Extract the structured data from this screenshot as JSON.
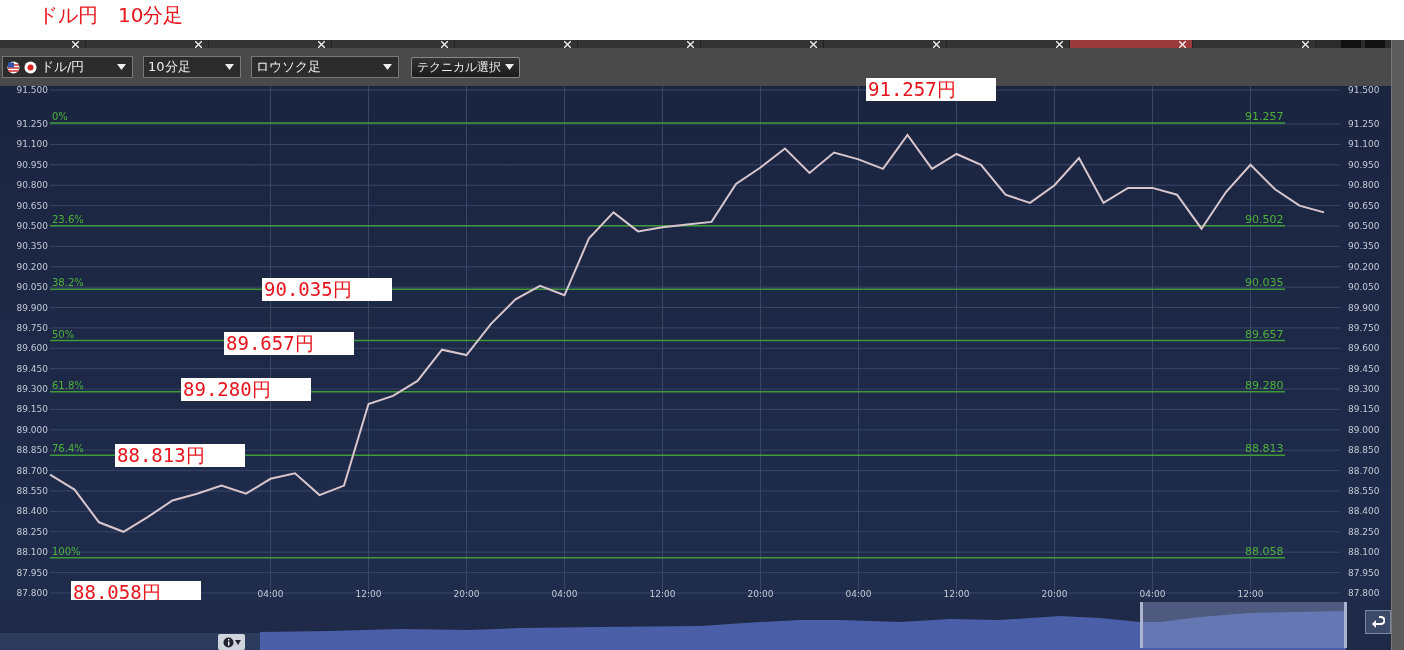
{
  "page_title": "ドル円　10分足",
  "tab_strip": {
    "tabs": [
      {
        "selected": false
      },
      {
        "selected": false
      },
      {
        "selected": false
      },
      {
        "selected": false
      },
      {
        "selected": false
      },
      {
        "selected": false
      },
      {
        "selected": false
      },
      {
        "selected": false
      },
      {
        "selected": false
      },
      {
        "selected": true
      },
      {
        "selected": false
      }
    ]
  },
  "toolbar": {
    "pair_select": {
      "value": "ドル/円"
    },
    "interval_select": {
      "value": "10分足"
    },
    "chart_type_select": {
      "value": "ロウソク足"
    },
    "technical_button": {
      "label": "テクニカル選択"
    }
  },
  "chart": {
    "chart_data": {
      "type": "line",
      "grid": true,
      "ylim": [
        87.77,
        91.53
      ],
      "categories": [
        null,
        null,
        null,
        null,
        null,
        null,
        null,
        null,
        null,
        "04:00",
        null,
        null,
        null,
        "12:00",
        null,
        null,
        null,
        "20:00",
        null,
        null,
        null,
        "04:00",
        null,
        null,
        null,
        "12:00",
        null,
        null,
        null,
        "20:00",
        null,
        null,
        null,
        "04:00",
        null,
        null,
        null,
        "12:00",
        null,
        null,
        null,
        "20:00",
        null,
        null,
        null,
        "04:00",
        null,
        null,
        null,
        "12:00",
        null,
        null,
        null
      ],
      "yticks": [
        {
          "value": 91.5,
          "label": "91.500"
        },
        {
          "value": 91.25,
          "label": "91.250"
        },
        {
          "value": 91.1,
          "label": "91.100"
        },
        {
          "value": 90.95,
          "label": "90.950"
        },
        {
          "value": 90.8,
          "label": "90.800"
        },
        {
          "value": 90.65,
          "label": "90.650"
        },
        {
          "value": 90.5,
          "label": "90.500"
        },
        {
          "value": 90.35,
          "label": "90.350"
        },
        {
          "value": 90.2,
          "label": "90.200"
        },
        {
          "value": 90.05,
          "label": "90.050"
        },
        {
          "value": 89.9,
          "label": "89.900"
        },
        {
          "value": 89.75,
          "label": "89.750"
        },
        {
          "value": 89.6,
          "label": "89.600"
        },
        {
          "value": 89.45,
          "label": "89.450"
        },
        {
          "value": 89.3,
          "label": "89.300"
        },
        {
          "value": 89.15,
          "label": "89.150"
        },
        {
          "value": 89.0,
          "label": "89.000"
        },
        {
          "value": 88.85,
          "label": "88.850"
        },
        {
          "value": 88.7,
          "label": "88.700"
        },
        {
          "value": 88.55,
          "label": "88.550"
        },
        {
          "value": 88.4,
          "label": "88.400"
        },
        {
          "value": 88.25,
          "label": "88.250"
        },
        {
          "value": 88.1,
          "label": "88.100"
        },
        {
          "value": 87.95,
          "label": "87.950"
        },
        {
          "value": 87.8,
          "label": "87.800"
        }
      ],
      "series": [
        {
          "color": "#d9c6cc",
          "values": [
            88.67,
            88.56,
            88.32,
            88.25,
            88.36,
            88.48,
            88.53,
            88.59,
            88.53,
            88.64,
            88.68,
            88.52,
            88.59,
            89.19,
            89.25,
            89.36,
            89.59,
            89.55,
            89.78,
            89.96,
            90.06,
            89.99,
            90.41,
            90.6,
            90.46,
            90.49,
            90.51,
            90.53,
            90.81,
            90.93,
            91.07,
            90.89,
            91.04,
            90.99,
            90.92,
            91.17,
            90.92,
            91.03,
            90.95,
            90.73,
            90.67,
            90.8,
            91.0,
            90.67,
            90.78,
            90.78,
            90.73,
            90.48,
            90.75,
            90.95,
            90.77,
            90.65,
            90.6
          ]
        }
      ]
    },
    "right_axis_labels": [
      "91.500",
      "91.250",
      "91.100",
      "90.950",
      "90.800",
      "90.650",
      "90.500",
      "90.350",
      "90.200",
      "90.050",
      "89.900",
      "89.750",
      "89.600",
      "89.450",
      "89.300",
      "89.150",
      "89.000",
      "88.850",
      "88.700",
      "88.550",
      "88.400",
      "88.250",
      "88.100",
      "87.950",
      "87.800"
    ],
    "fibonacci_levels": [
      {
        "percent": "0%",
        "price": "91.257",
        "callout": "91.257円"
      },
      {
        "percent": "23.6%",
        "price": "90.502"
      },
      {
        "percent": "38.2%",
        "price": "90.035",
        "callout": "90.035円"
      },
      {
        "percent": "50%",
        "price": "89.657",
        "callout": "89.657円"
      },
      {
        "percent": "61.8%",
        "price": "89.280",
        "callout": "89.280円"
      },
      {
        "percent": "76.4%",
        "price": "88.813",
        "callout": "88.813円"
      },
      {
        "percent": "100%",
        "price": "88.058",
        "callout": "88.058円"
      }
    ]
  }
}
